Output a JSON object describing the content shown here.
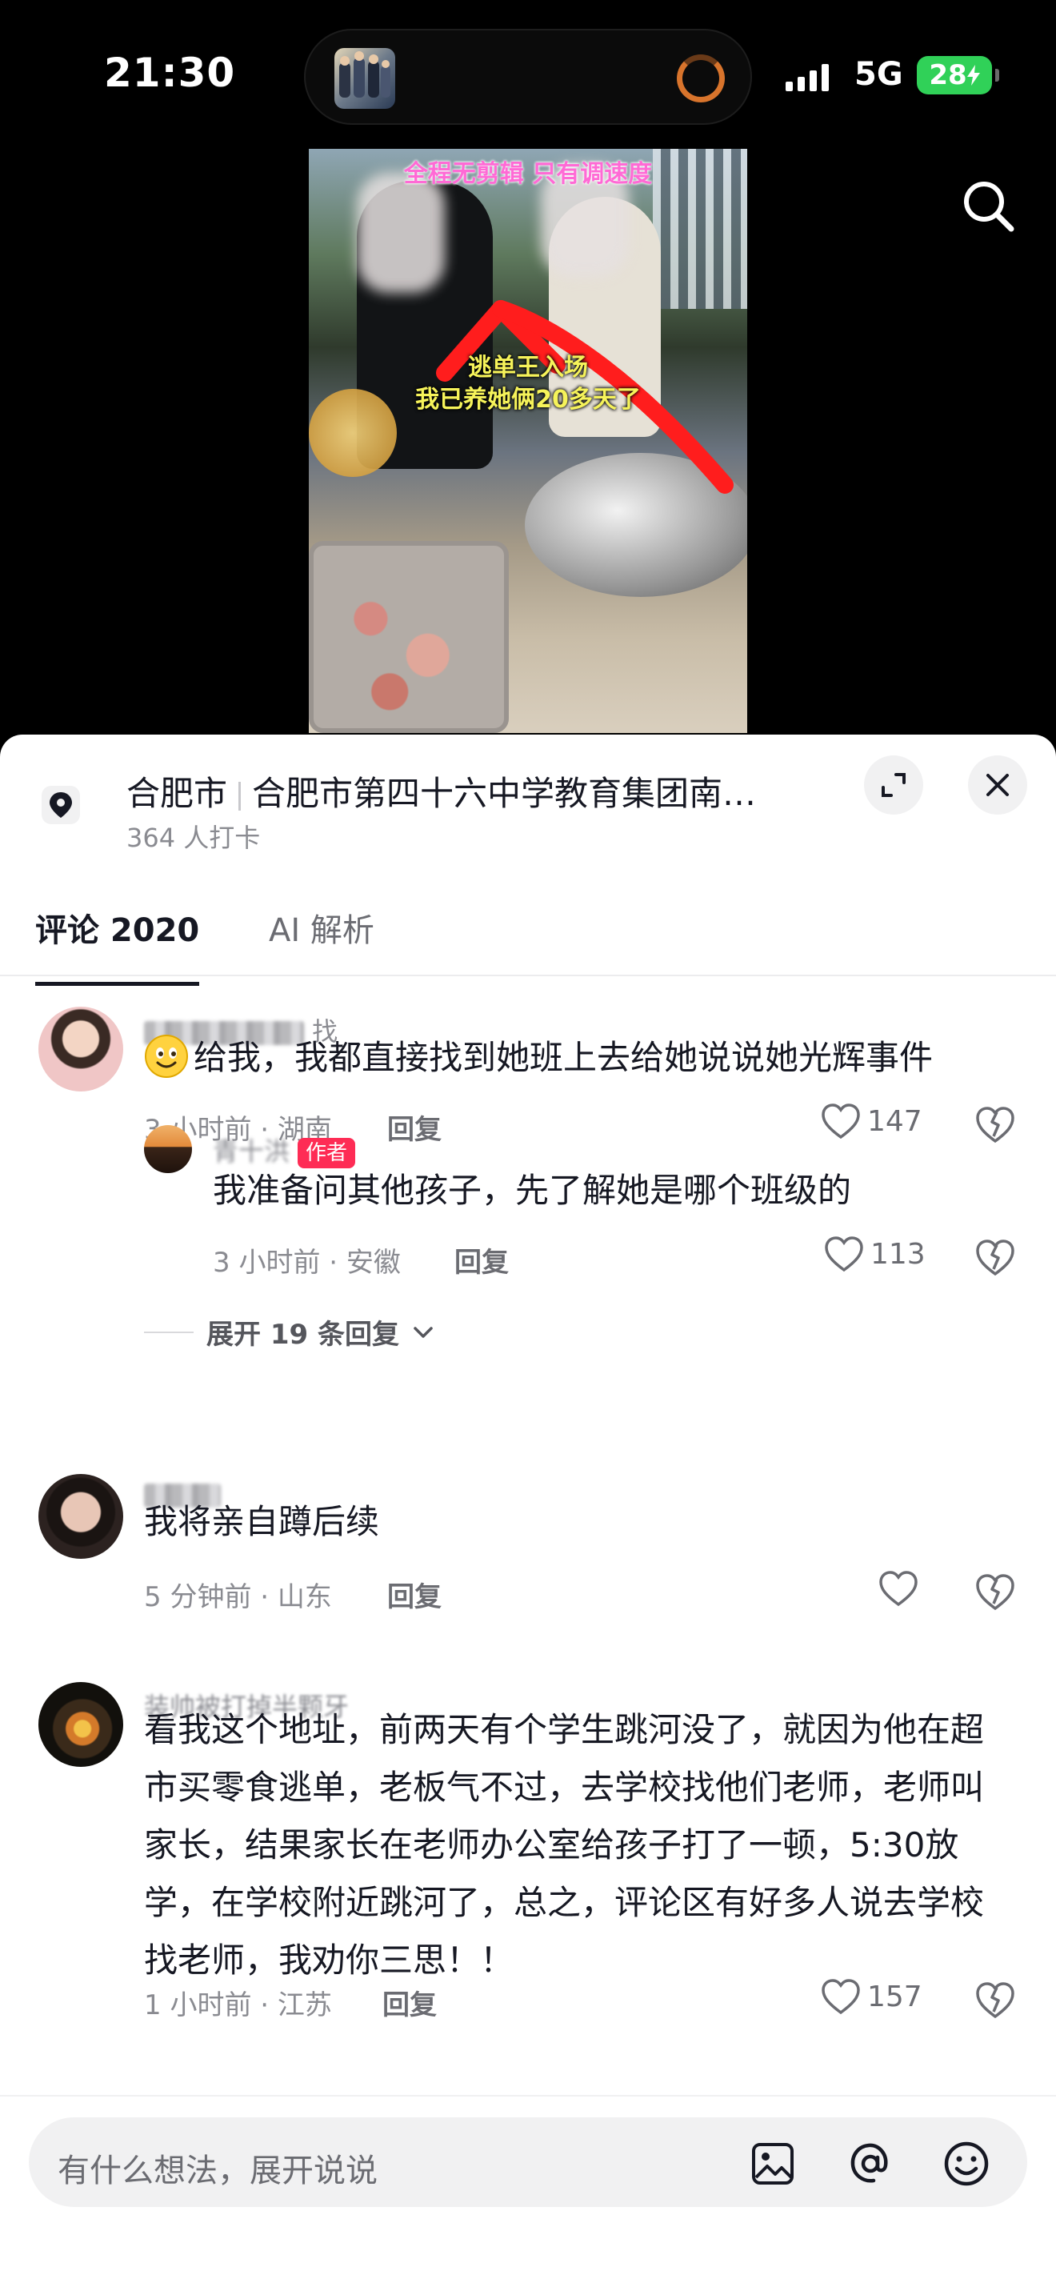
{
  "status_bar": {
    "time": "21:30",
    "network": "5G",
    "battery": "28"
  },
  "video": {
    "caption_top": "全程无剪辑 只有调速度",
    "caption_line1": "逃单王入场",
    "caption_line2": "我已养她俩20多天了"
  },
  "location": {
    "city": "合肥市",
    "place": "合肥市第四十六中学教育集团南…",
    "checkins": "364 人打卡"
  },
  "tabs": {
    "comments": "评论 2020",
    "ai": "AI 解析"
  },
  "comments": [
    {
      "username_visible": "找",
      "text": "给我，我都直接找到她班上去给她说说她光辉事件",
      "time_region": "3 小时前 · 湖南",
      "reply_label": "回复",
      "likes": "147",
      "replies": [
        {
          "username_visible": "青十洪",
          "badge": "作者",
          "text": "我准备问其他孩子，先了解她是哪个班级的",
          "time_region": "3 小时前 · 安徽",
          "reply_label": "回复",
          "likes": "113"
        }
      ],
      "expand_label": "展开 19 条回复"
    },
    {
      "username_visible": "",
      "text": "我将亲自蹲后续",
      "time_region": "5 分钟前 · 山东",
      "reply_label": "回复",
      "likes": ""
    },
    {
      "username_visible": "装帅被打掉半颗牙",
      "text": "看我这个地址，前两天有个学生跳河没了，就因为他在超市买零食逃单，老板气不过，去学校找他们老师，老师叫家长，结果家长在老师办公室给孩子打了一顿，5:30放学，在学校附近跳河了，总之，评论区有好多人说去学校找老师，我劝你三思！！",
      "time_region": "1 小时前 · 江苏",
      "reply_label": "回复",
      "likes": "157"
    }
  ],
  "input": {
    "placeholder": "有什么想法，展开说说"
  },
  "colors": {
    "accent": "#fe2c55",
    "battery": "#30d158",
    "text": "#161823",
    "muted": "#8a8b91"
  },
  "icons": [
    "search-icon",
    "location-pin-icon",
    "minimize-icon",
    "close-icon",
    "heart-icon",
    "dislike-heart-icon",
    "chevron-down-icon",
    "image-icon",
    "at-icon",
    "emoji-icon"
  ]
}
